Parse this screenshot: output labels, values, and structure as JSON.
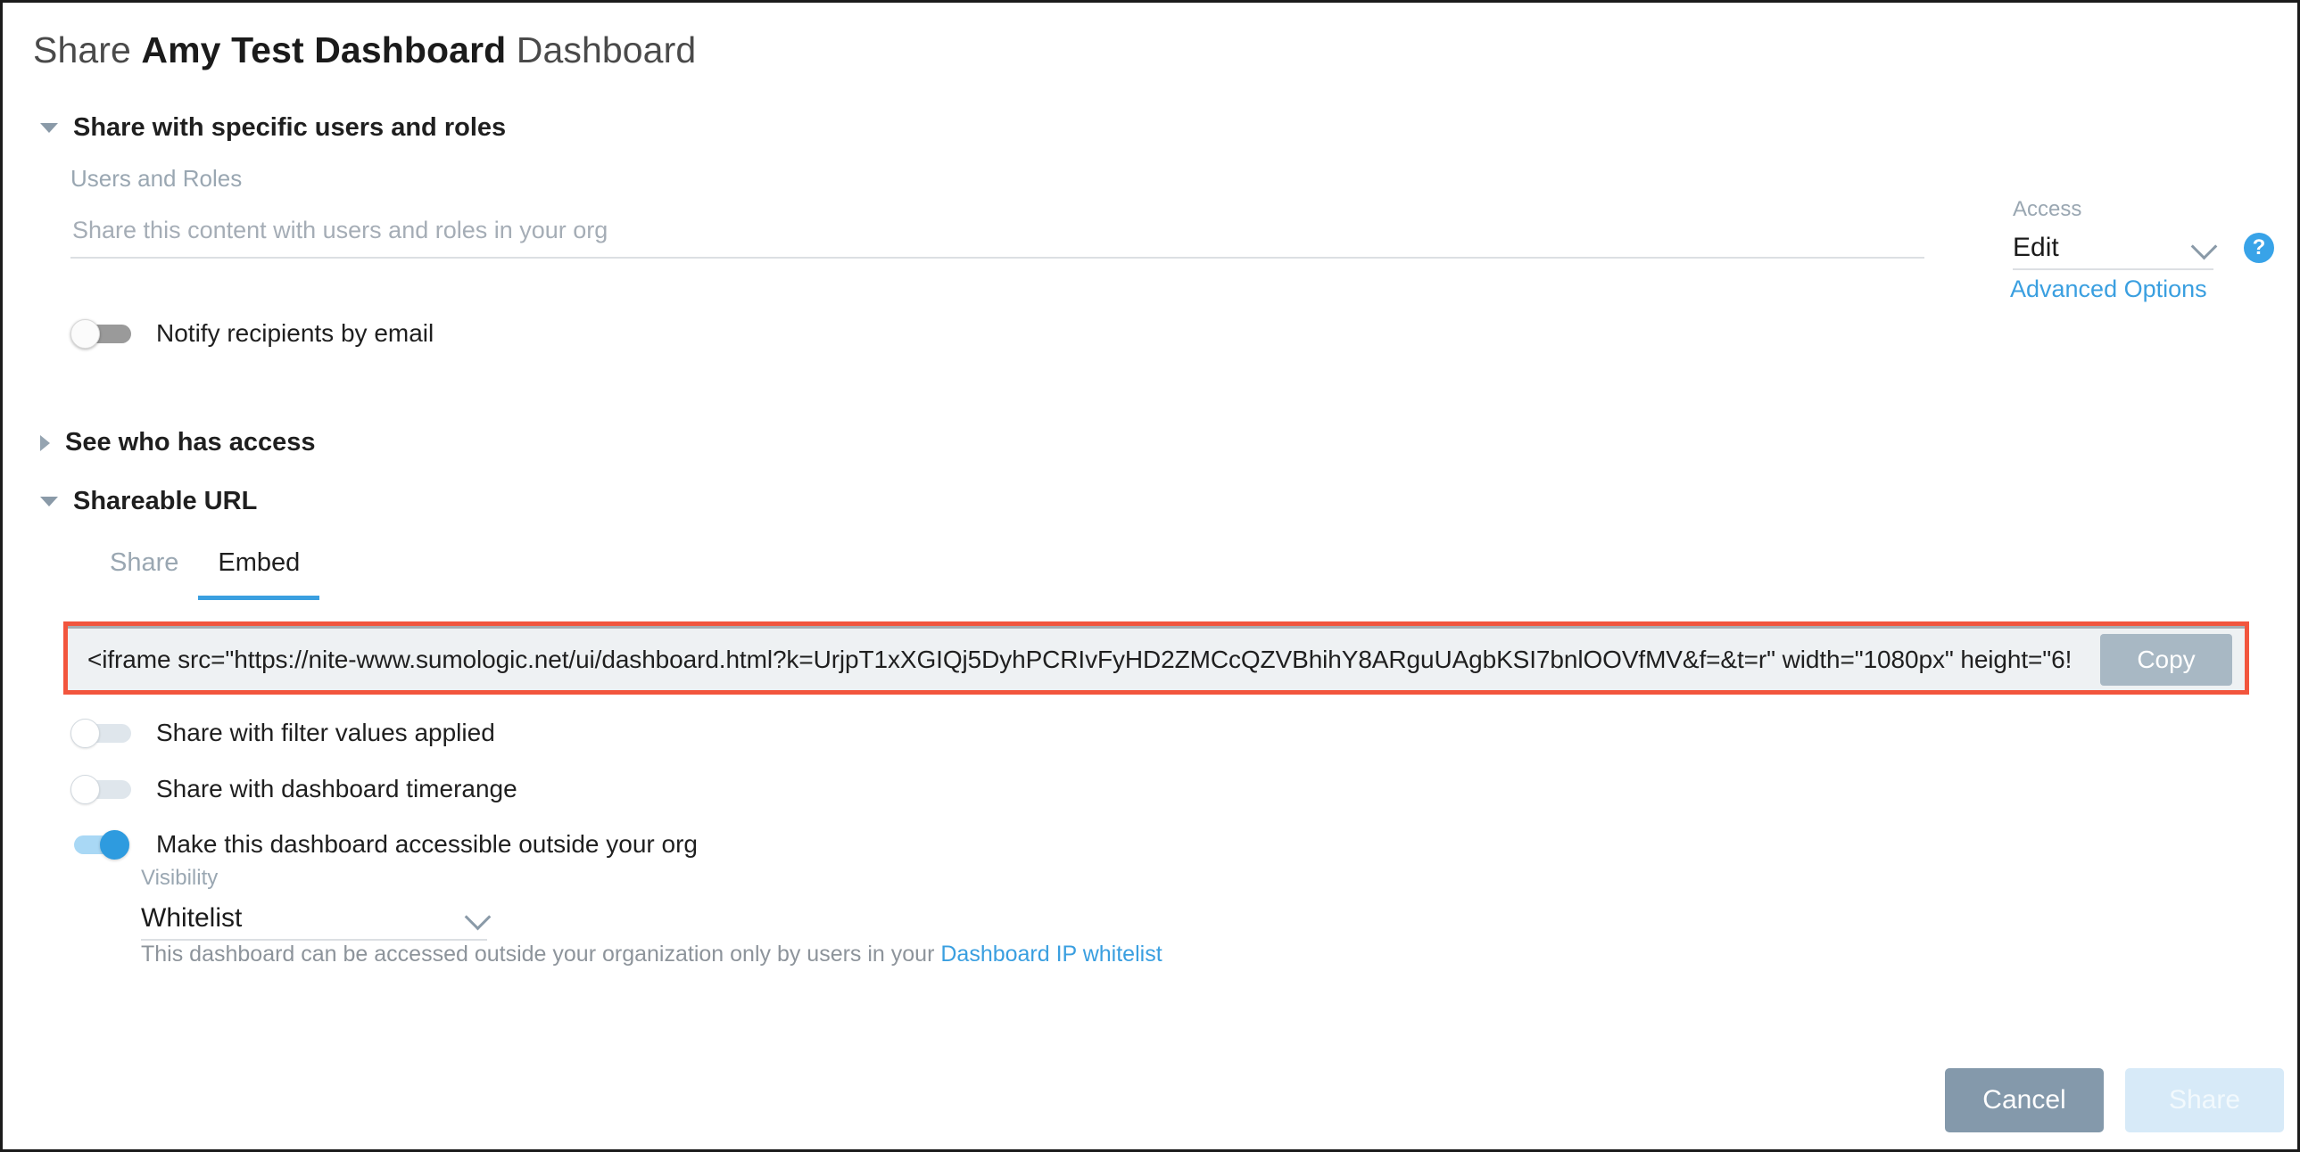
{
  "dialog": {
    "title_prefix": "Share ",
    "title_name": "Amy Test Dashboard",
    "title_suffix": " Dashboard"
  },
  "share_with_users": {
    "section_label": "Share with specific users and roles",
    "users_roles_label": "Users and Roles",
    "users_roles_placeholder": "Share this content with users and roles in your org",
    "users_roles_value": "",
    "notify_label": "Notify recipients by email",
    "notify_state": "off"
  },
  "access": {
    "label": "Access",
    "value": "Edit",
    "help_icon": "?",
    "advanced_options_label": "Advanced Options"
  },
  "see_who_has_access": {
    "section_label": "See who has access",
    "expanded": false
  },
  "shareable_url": {
    "section_label": "Shareable URL",
    "expanded": true,
    "tabs": [
      {
        "label": "Share",
        "active": false
      },
      {
        "label": "Embed",
        "active": true
      }
    ],
    "embed_code": "<iframe src=\"https://nite-www.sumologic.net/ui/dashboard.html?k=UrjpT1xXGIQj5DyhPCRIvFyHD2ZMCcQZVBhihY8ARguUAgbKSI7bnlOOVfMV&f=&t=r\" width=\"1080px\" height=\"6!",
    "copy_label": "Copy",
    "options": [
      {
        "label": "Share with filter values applied",
        "state": "off"
      },
      {
        "label": "Share with dashboard timerange",
        "state": "off"
      },
      {
        "label": "Make this dashboard accessible outside your org",
        "state": "on"
      }
    ],
    "visibility_label": "Visibility",
    "visibility_value": "Whitelist",
    "visibility_help_text": "This dashboard can be accessed outside your organization only by users in your ",
    "visibility_help_link": "Dashboard IP whitelist"
  },
  "footer": {
    "cancel_label": "Cancel",
    "share_label": "Share"
  },
  "colors": {
    "accent_blue": "#3a9fe0",
    "toggle_on": "#2e9bdf",
    "highlight_red": "#f2553d",
    "cancel_gray": "#8499ab",
    "share_disabled": "#d7eaf8",
    "copy_button": "#a8b8c4"
  }
}
